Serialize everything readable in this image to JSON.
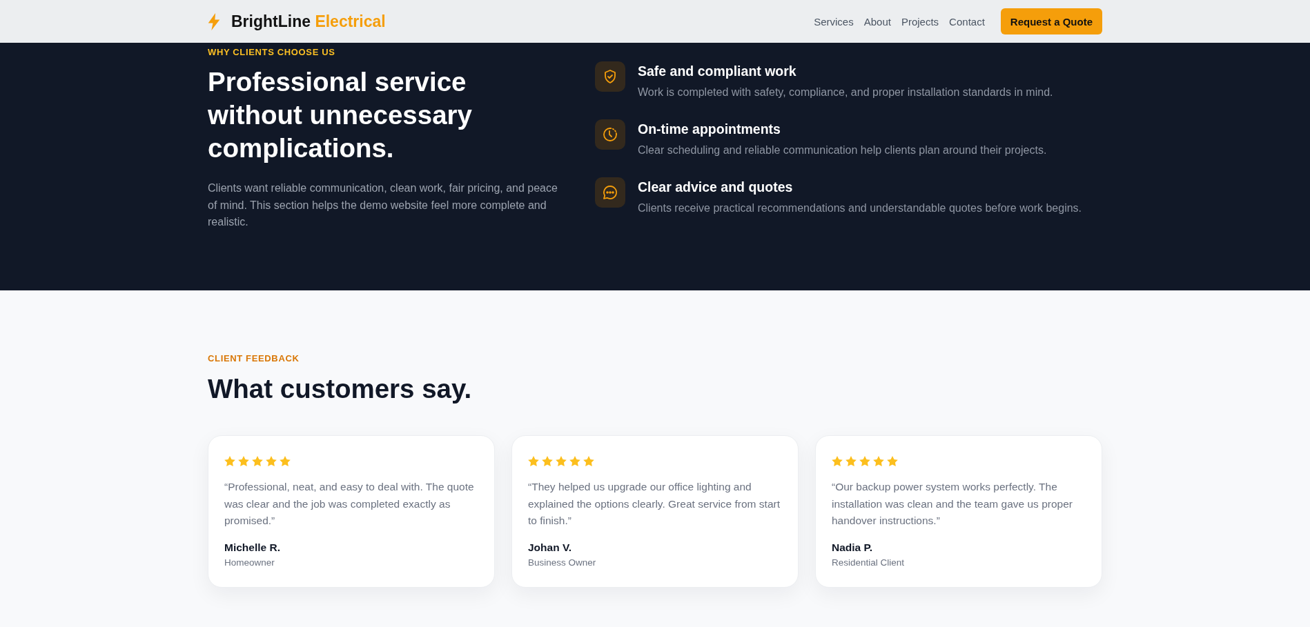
{
  "header": {
    "brand": {
      "name": "BrightLine",
      "accent": "Electrical"
    },
    "nav": [
      "Services",
      "About",
      "Projects",
      "Contact"
    ],
    "cta": "Request a Quote"
  },
  "why_section": {
    "eyebrow": "WHY CLIENTS CHOOSE US",
    "heading": "Professional service without unnecessary complications.",
    "description": "Clients want reliable communication, clean work, fair pricing, and peace of mind. This section helps the demo website feel more complete and realistic.",
    "features": [
      {
        "title": "Safe and compliant work",
        "description": "Work is completed with safety, compliance, and proper installation standards in mind."
      },
      {
        "title": "On-time appointments",
        "description": "Clear scheduling and reliable communication help clients plan around their projects."
      },
      {
        "title": "Clear advice and quotes",
        "description": "Clients receive practical recommendations and understandable quotes before work begins."
      }
    ]
  },
  "testimonials": {
    "eyebrow": "CLIENT FEEDBACK",
    "heading": "What customers say.",
    "cards": [
      {
        "stars": 5,
        "quote": "“Professional, neat, and easy to deal with. The quote was clear and the job was completed exactly as promised.”",
        "name": "Michelle R.",
        "role": "Homeowner"
      },
      {
        "stars": 5,
        "quote": "“They helped us upgrade our office lighting and explained the options clearly. Great service from start to finish.”",
        "name": "Johan V.",
        "role": "Business Owner"
      },
      {
        "stars": 5,
        "quote": "“Our backup power system works perfectly. The installation was clean and the team gave us proper handover instructions.”",
        "name": "Nadia P.",
        "role": "Residential Client"
      }
    ]
  }
}
